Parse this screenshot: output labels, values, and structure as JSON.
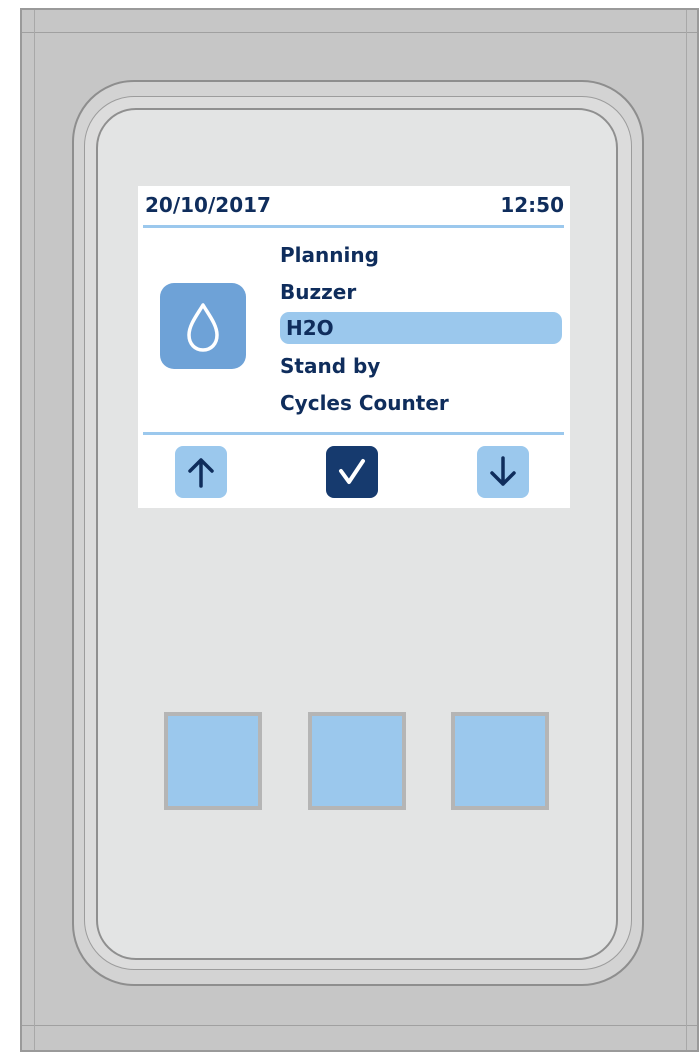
{
  "screen": {
    "status_bar": {
      "date": "20/10/2017",
      "time": "12:50"
    },
    "menu": {
      "items": [
        {
          "label": "Planning",
          "selected": false
        },
        {
          "label": "Buzzer",
          "selected": false
        },
        {
          "label": "H2O",
          "selected": true
        },
        {
          "label": "Stand by",
          "selected": false
        },
        {
          "label": "Cycles Counter",
          "selected": false
        }
      ]
    },
    "section_icon": "water-drop-icon",
    "nav": {
      "up_icon": "arrow-up-icon",
      "confirm_icon": "checkmark-icon",
      "down_icon": "arrow-down-icon"
    }
  },
  "hardware_buttons": {
    "count": 3,
    "color": "#9bc8ed"
  },
  "colors": {
    "text_primary": "#0f2d5c",
    "accent_light": "#9bc8ed",
    "accent_dark": "#163a6e",
    "icon_tile": "#6ea2d7"
  }
}
